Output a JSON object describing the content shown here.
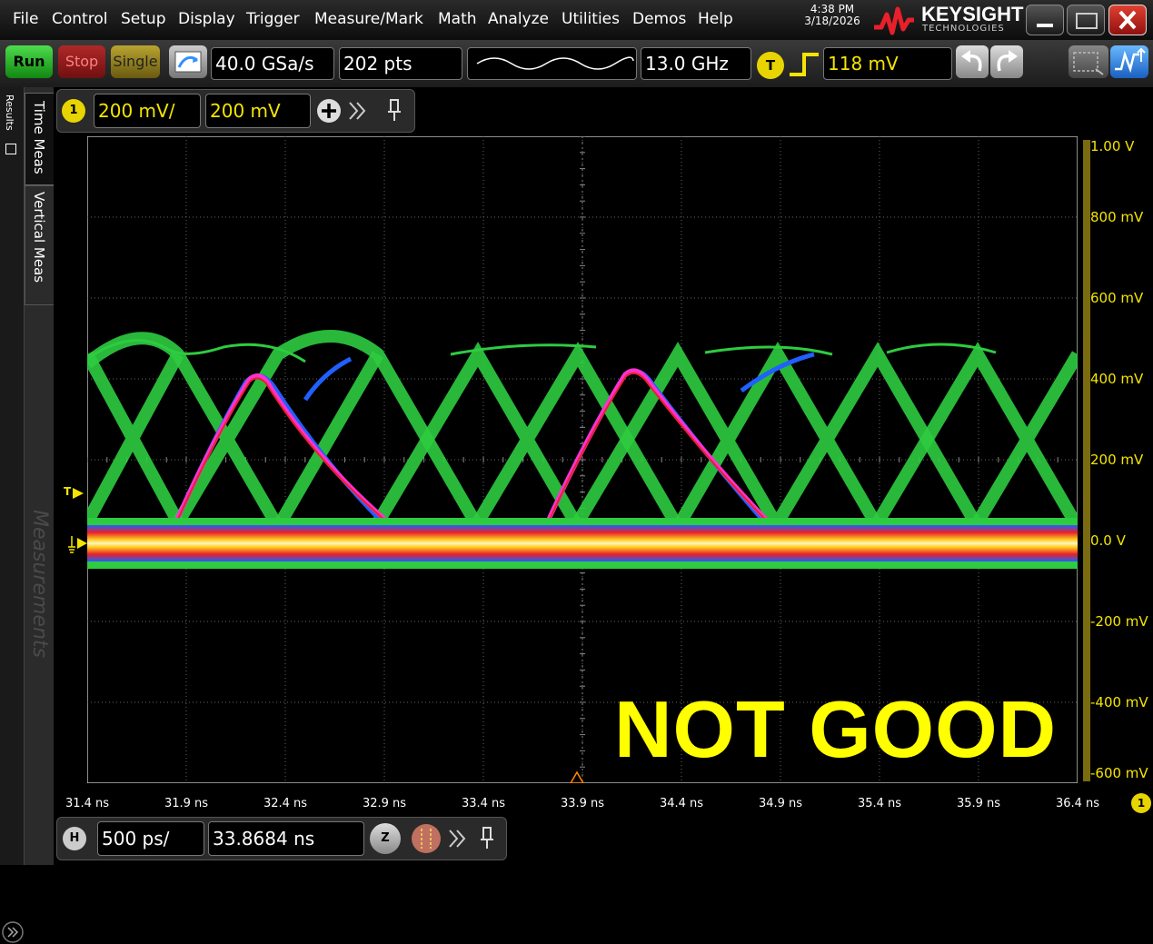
{
  "menu": [
    "File",
    "Control",
    "Setup",
    "Display",
    "Trigger",
    "Measure/Mark",
    "Math",
    "Analyze",
    "Utilities",
    "Demos",
    "Help"
  ],
  "clock": {
    "time": "4:38 PM",
    "date": "3/18/2026"
  },
  "brand": {
    "name": "KEYSIGHT",
    "sub": "TECHNOLOGIES"
  },
  "acq": {
    "run": "Run",
    "stop": "Stop",
    "single": "Single",
    "sample_rate": "40.0 GSa/s",
    "points": "202 pts",
    "bandwidth": "13.0 GHz",
    "trigger_badge": "T",
    "trigger_level": "118 mV"
  },
  "channel": {
    "badge": "1",
    "scale": "200 mV/",
    "offset": "200 mV"
  },
  "horizontal": {
    "badge": "H",
    "scale": "500 ps/",
    "position": "33.8684 ns",
    "zoom_badge": "Z"
  },
  "side": {
    "results": "Results",
    "time_meas": "Time Meas",
    "vertical_meas": "Vertical Meas",
    "measurements": "Measurements"
  },
  "axis": {
    "y_labels": [
      "1.00 V",
      "800 mV",
      "600 mV",
      "400 mV",
      "200 mV",
      "0.0 V",
      "-200 mV",
      "-400 mV",
      "-600 mV"
    ],
    "x_labels": [
      "31.4 ns",
      "31.9 ns",
      "32.4 ns",
      "32.9 ns",
      "33.4 ns",
      "33.9 ns",
      "34.4 ns",
      "34.9 ns",
      "35.4 ns",
      "35.9 ns",
      "36.4 ns"
    ],
    "channel_marker": "1"
  },
  "markers": {
    "trigger": "T"
  },
  "overlay": "NOT GOOD",
  "colors": {
    "trace_green": "#2ecc40",
    "trace_blue": "#2060ff",
    "trace_magenta": "#ff30d0",
    "trace_red": "#e8202a",
    "baseline_yellow": "#ffe640",
    "channel_yellow": "#f4e500",
    "run_green": "#22aa22",
    "stop_red": "#b02020",
    "single_olive": "#a09020"
  }
}
